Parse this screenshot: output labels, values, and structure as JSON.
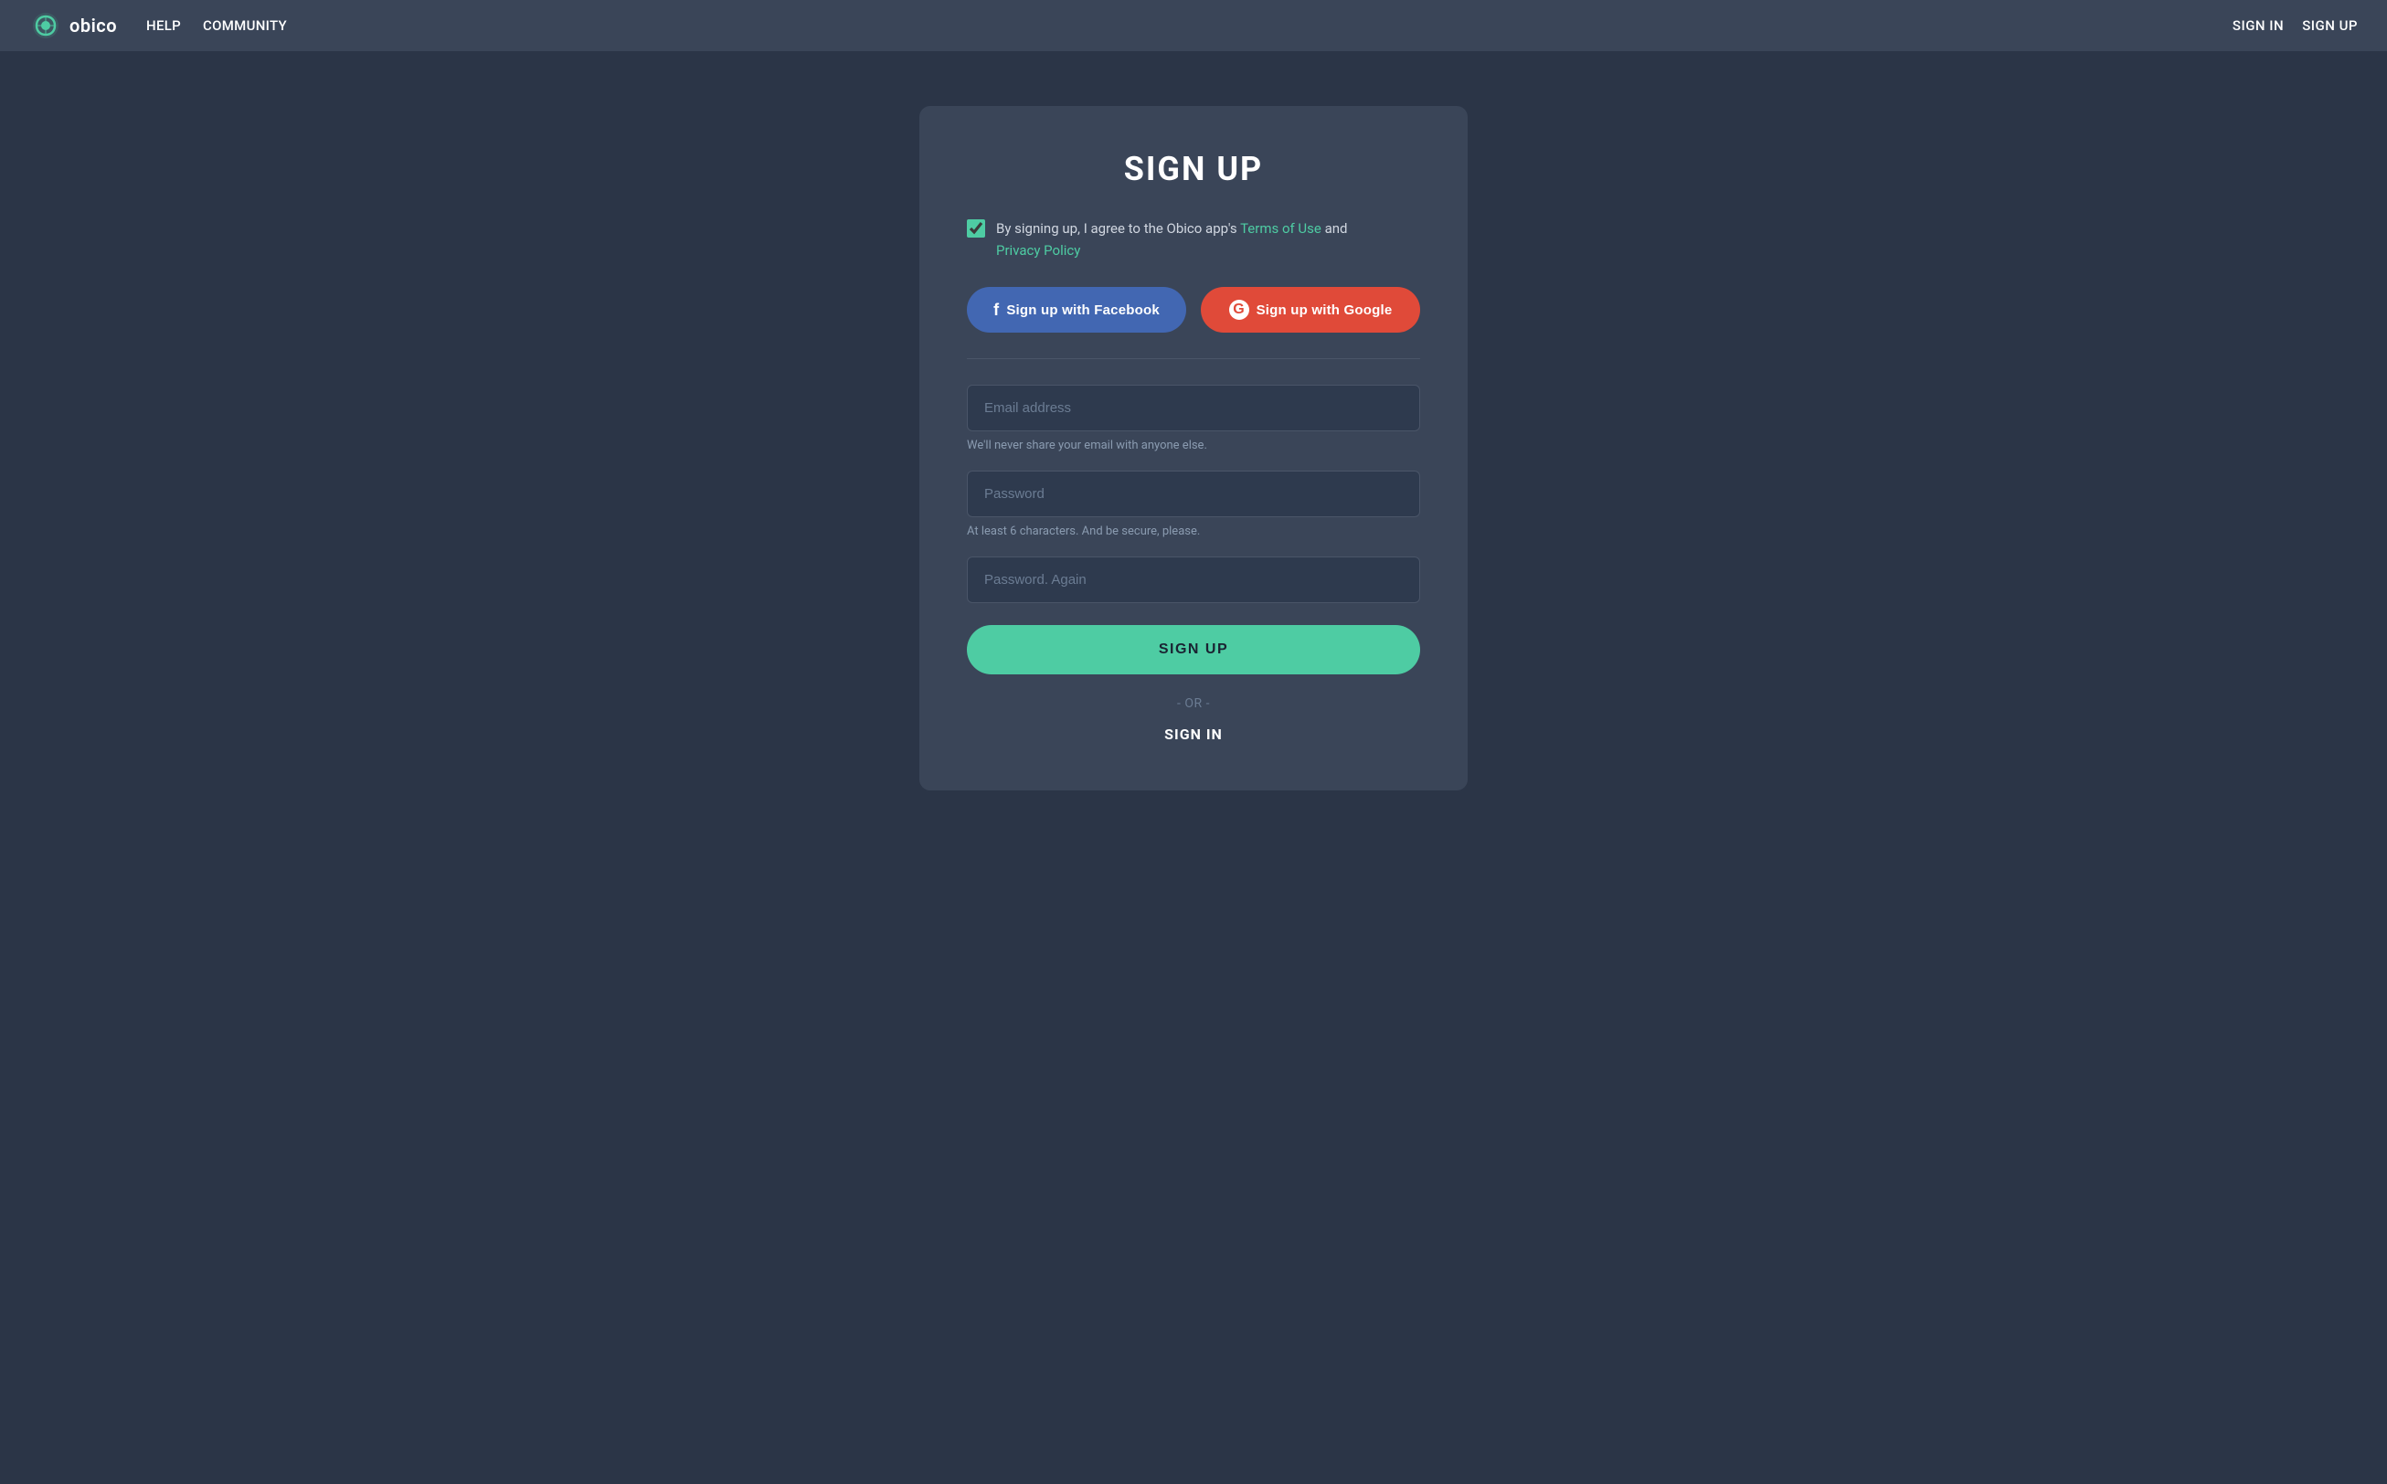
{
  "nav": {
    "logo_text": "obico",
    "links": [
      {
        "label": "HELP",
        "name": "nav-link-help"
      },
      {
        "label": "COMMUNITY",
        "name": "nav-link-community"
      }
    ],
    "auth_links": [
      {
        "label": "SIGN IN",
        "name": "nav-signin"
      },
      {
        "label": "SIGN UP",
        "name": "nav-signup"
      }
    ]
  },
  "signup": {
    "title": "SIGN UP",
    "terms_text_before": "By signing up, I agree to the Obico app's ",
    "terms_of_use": "Terms of Use",
    "terms_text_middle": " and",
    "privacy_policy": "Privacy Policy",
    "facebook_btn": "Sign up with Facebook",
    "google_btn": "Sign up with Google",
    "email_placeholder": "Email address",
    "email_hint": "We'll never share your email with anyone else.",
    "password_placeholder": "Password",
    "password_hint": "At least 6 characters. And be secure, please.",
    "password_again_placeholder": "Password. Again",
    "signup_btn": "SIGN UP",
    "or_text": "- OR -",
    "signin_link": "SIGN IN"
  },
  "colors": {
    "teal": "#4ecca3",
    "facebook_blue": "#4267b2",
    "google_red": "#e04a39",
    "nav_bg": "#3a4558",
    "page_bg": "#2b3547",
    "card_bg": "#3a4558",
    "input_bg": "#2e3a4e"
  }
}
